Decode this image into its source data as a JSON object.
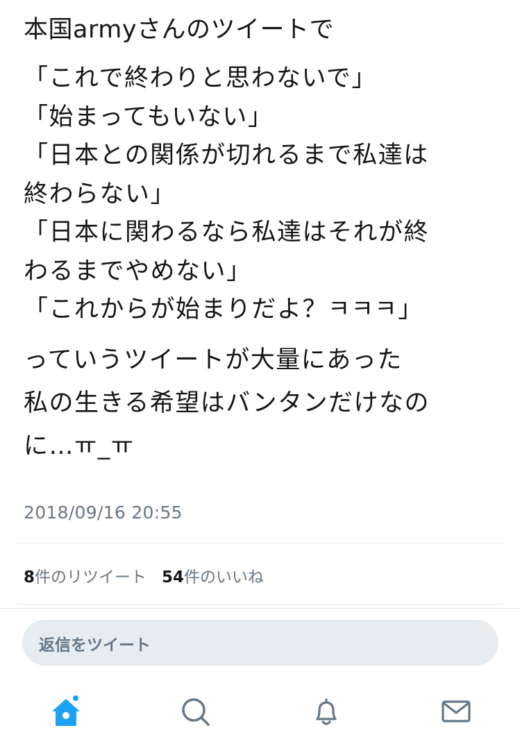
{
  "tweet": {
    "intro": "本国armyさんのツイートで",
    "quotes": [
      "「これで終わりと思わないで」",
      "「始まってもいない」",
      "「日本との関係が切れるまで私達は",
      "終わらない」",
      "「日本に関わるなら私達はそれが終",
      "わるまでやめない」",
      "「これからが始まりだよ？ㅋㅋㅋ」"
    ],
    "outro": [
      "っていうツイートが大量にあった",
      "私の生きる希望はバンタンだけなの",
      "に…ㅠ_ㅠ"
    ],
    "timestamp": "2018/09/16 20:55"
  },
  "stats": {
    "retweet_count": "8",
    "retweet_label": "件のリツイート",
    "like_count": "54",
    "like_label": "件のいいね"
  },
  "reply": {
    "placeholder": "返信をツイート"
  },
  "tabbar": {
    "tabs": [
      {
        "icon": "home-icon",
        "active": true,
        "badge": true
      },
      {
        "icon": "search-icon",
        "active": false
      },
      {
        "icon": "bell-icon",
        "active": false
      },
      {
        "icon": "envelope-icon",
        "active": false
      }
    ]
  },
  "colors": {
    "text": "#14171a",
    "secondary": "#657786",
    "accent": "#1da1f2",
    "divider": "#e1e8ed",
    "reply_bg": "#e6ecf0"
  }
}
